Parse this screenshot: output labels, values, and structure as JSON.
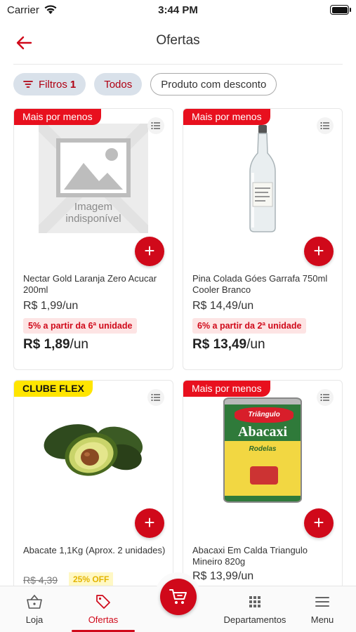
{
  "status_bar": {
    "carrier": "Carrier",
    "time": "3:44 PM"
  },
  "header": {
    "title": "Ofertas"
  },
  "filters": {
    "filtros_label": "Filtros",
    "filtros_count": "1",
    "todos_label": "Todos",
    "desconto_label": "Produto com desconto"
  },
  "products": [
    {
      "badge": "Mais por menos",
      "image_placeholder_line1": "Imagem",
      "image_placeholder_line2": "indisponível",
      "name": "Nectar Gold Laranja Zero Acucar 200ml",
      "price": "R$ 1,99/un",
      "promo": "5% a partir da 6ª unidade",
      "final_price": "R$ 1,89",
      "final_unit": "/un"
    },
    {
      "badge": "Mais por menos",
      "name": "Pina Colada Góes Garrafa 750ml Cooler Branco",
      "price": "R$ 14,49/un",
      "promo": "6% a partir da 2ª unidade",
      "final_price": "R$ 13,49",
      "final_unit": "/un"
    },
    {
      "badge": "CLUBE FLEX",
      "name": "Abacate 1,1Kg (Aprox. 2 unidades)",
      "old_price": "R$ 4,39",
      "off": "25% OFF"
    },
    {
      "badge": "Mais por menos",
      "can_brand": "Triângulo",
      "can_title": "Abacaxi",
      "can_subtitle": "Rodelas",
      "name": "Abacaxi Em Calda Triangulo Mineiro 820g",
      "price": "R$ 13,99/un"
    }
  ],
  "bottom_nav": {
    "loja": "Loja",
    "ofertas": "Ofertas",
    "departamentos": "Departamentos",
    "menu": "Menu"
  },
  "colors": {
    "brand_red": "#d0091a",
    "badge_red": "#e8101e",
    "clube_yellow": "#ffe500"
  }
}
